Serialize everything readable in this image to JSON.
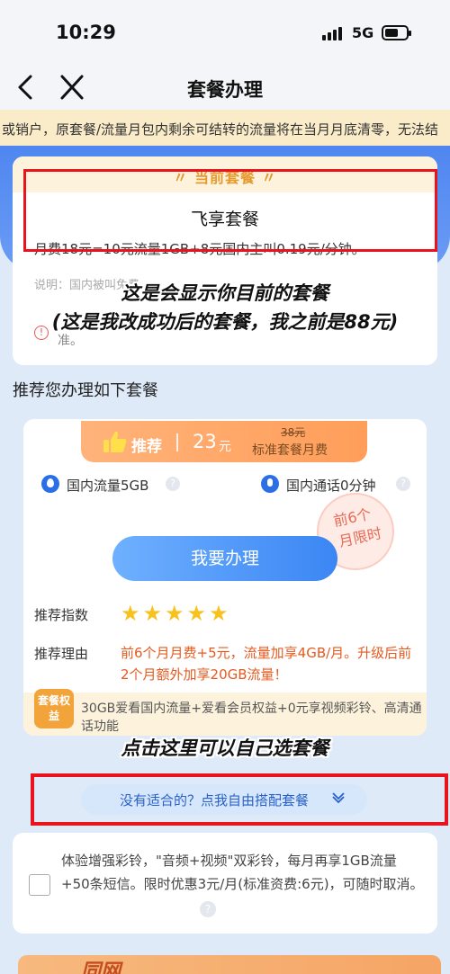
{
  "status": {
    "time": "10:29",
    "network": "5G"
  },
  "nav": {
    "title": "套餐办理"
  },
  "notice": {
    "text": "或销户，原套餐/流量月包内剩余可结转的流量将在当月月底清零，无法结"
  },
  "current_plan": {
    "title": "〃 当前套餐 〃",
    "name": "飞享套餐",
    "desc": "月费18元=10元流量1GB+8元国内主叫0.19元/分钟。",
    "note": "说明：国内被叫免费",
    "note2": "加名",
    "warn_text": "准。"
  },
  "overlays": {
    "line1": "这是会显示你目前的套餐",
    "line2": "(这是我改成功后的套餐，我之前是88元)",
    "line3": "点击这里可以自己选套餐"
  },
  "section": {
    "title": "推荐您办理如下套餐"
  },
  "recommend": {
    "tag": "推荐",
    "price": "23",
    "price_unit": "元",
    "old_price": "38元",
    "old_price_label": "标准套餐月费",
    "feature1": "国内流量5GB",
    "feature2": "国内通话0分钟",
    "stamp_line1": "前6个",
    "stamp_line2": "月限时",
    "apply_button": "我要办理",
    "index_label": "推荐指数",
    "stars": "★★★★★",
    "reason_label": "推荐理由",
    "reason_text": "前6个月月费+5元，流量加享4GB/月。升级后前2个月额外加享20GB流量！",
    "perk_badge": "套餐权益",
    "perk_text": "30GB爱看国内流量+爱看会员权益+0元享视频彩铃、高清通话功能"
  },
  "diy": {
    "label": "没有适合的？点我自由搭配套餐"
  },
  "addon": {
    "text": "体验增强彩铃，\"音频+视频\"双彩铃，每月再享1GB流量+50条短信。限时优惠3元/月(标准资费:6元)，可随时取消。"
  },
  "promo": {
    "text": "同网"
  },
  "icons": {
    "thumb": "thumbs-up-icon",
    "drop": "water-drop-icon",
    "mic": "microphone-icon",
    "help": "question-icon",
    "chevron": "chevron-down-icon"
  }
}
